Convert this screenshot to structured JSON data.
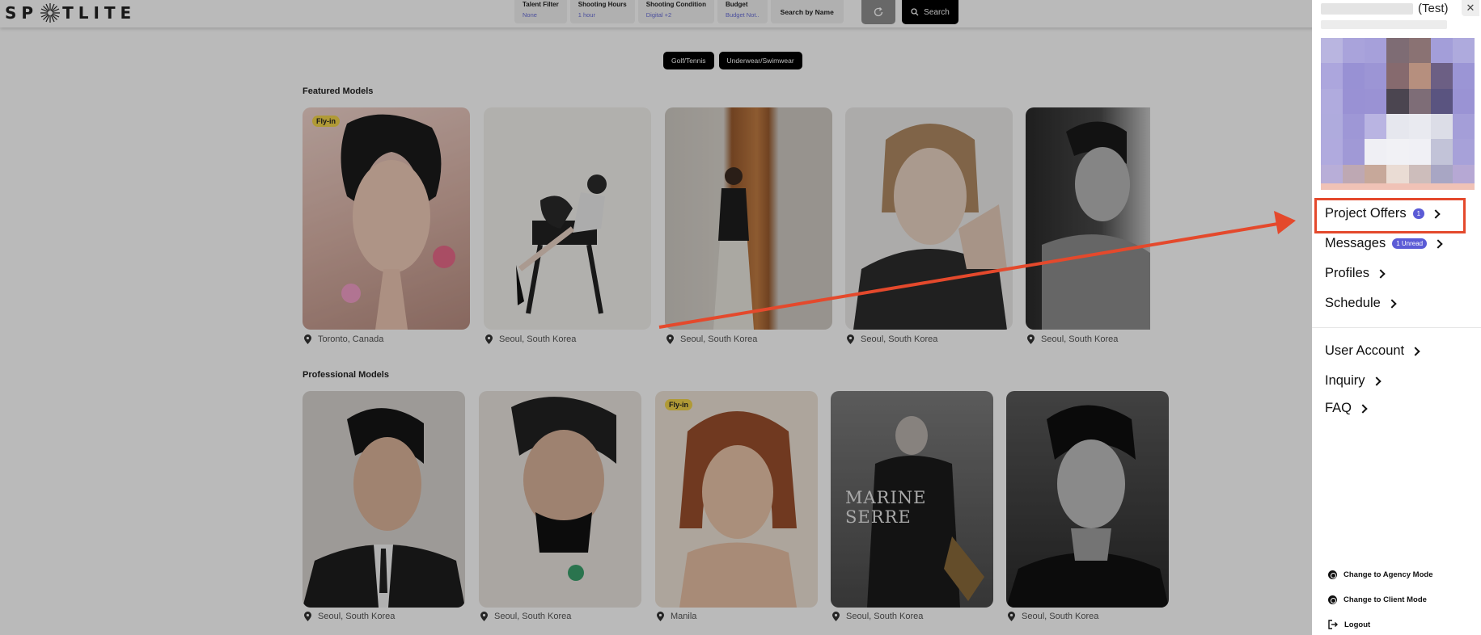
{
  "app": {
    "logo_text": "SPOTLITE"
  },
  "filters": [
    {
      "label": "Talent Filter",
      "value": "None"
    },
    {
      "label": "Shooting Hours",
      "value": "1 hour"
    },
    {
      "label": "Shooting Condition",
      "value": "Digital +2"
    },
    {
      "label": "Budget",
      "value": "Budget Not.."
    }
  ],
  "search": {
    "by_name_label": "Search by Name",
    "button_label": "Search"
  },
  "chips": [
    "Golf/Tennis",
    "Underwear/Swimwear"
  ],
  "featured": {
    "title": "Featured Models",
    "cards": [
      {
        "location": "Toronto, Canada",
        "badge": "Fly-in"
      },
      {
        "location": "Seoul, South Korea"
      },
      {
        "location": "Seoul, South Korea"
      },
      {
        "location": "Seoul, South Korea"
      },
      {
        "location": "Seoul, South Korea"
      }
    ]
  },
  "professional": {
    "title": "Professional Models",
    "cards": [
      {
        "location": "Seoul, South Korea"
      },
      {
        "location": "Seoul, South Korea"
      },
      {
        "location": "Manila",
        "badge": "Fly-in"
      },
      {
        "location": "Seoul, South Korea",
        "overlay_text": "MARINE SERRE"
      },
      {
        "location": "Seoul, South Korea"
      }
    ]
  },
  "panel": {
    "user_suffix": "(Test)",
    "menu": [
      {
        "label": "Project Offers",
        "badge": "1"
      },
      {
        "label": "Messages",
        "badge": "1 Unread"
      },
      {
        "label": "Profiles"
      },
      {
        "label": "Schedule"
      },
      {
        "label": "User Account"
      },
      {
        "label": "Inquiry"
      },
      {
        "label": "FAQ"
      }
    ],
    "footer": [
      {
        "label": "Change to Agency Mode"
      },
      {
        "label": "Change to Client Mode"
      },
      {
        "label": "Logout"
      }
    ]
  },
  "colors": {
    "accent": "#5b5bd6",
    "highlight": "#e4492c",
    "fly_in": "#f2d44a"
  }
}
